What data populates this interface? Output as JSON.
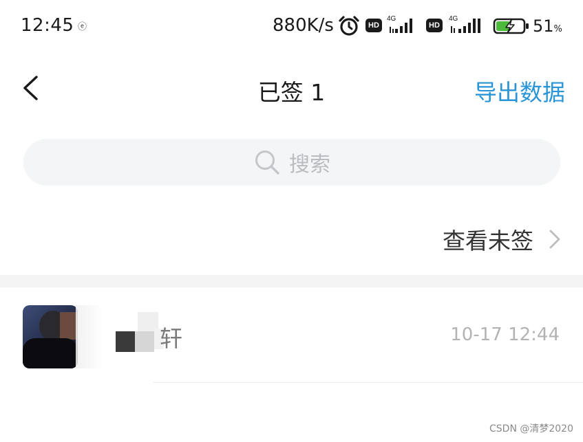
{
  "status_bar": {
    "time": "12:45",
    "notification_glyph": "ⓔ",
    "net_speed": "880K/s",
    "alarm_icon": "alarm-clock-icon",
    "sim1": {
      "hd_label": "HD",
      "network_label": "4G"
    },
    "sim2": {
      "hd_label": "HD",
      "network_label": "4G"
    },
    "battery_icon": "battery-charging-icon",
    "battery_level": 51,
    "battery_percent": "51",
    "battery_unit": "%"
  },
  "nav": {
    "back_icon": "back-chevron-icon",
    "title": "已签 1",
    "export_label": "导出数据",
    "accent_color": "#2a95d6"
  },
  "search": {
    "icon": "search-icon",
    "placeholder": "搜索"
  },
  "view_unsigned": {
    "label": "查看未签",
    "icon": "chevron-right-icon"
  },
  "signed_list": {
    "items": [
      {
        "name_visible": "轩",
        "time": "10-17 12:44"
      }
    ]
  },
  "watermark": "CSDN @清梦2020"
}
